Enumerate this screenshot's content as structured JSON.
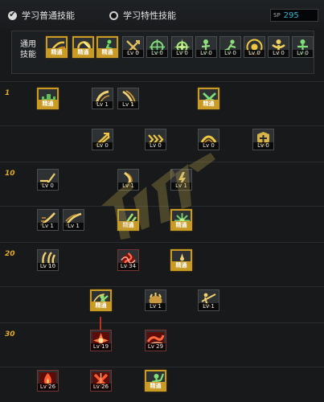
{
  "tabs": [
    {
      "label": "学习普通技能",
      "selected": true
    },
    {
      "label": "学习特性技能",
      "selected": false
    }
  ],
  "skill_points": {
    "label": "SP",
    "value": "295"
  },
  "common_skills": {
    "label": "通用技能",
    "items": [
      {
        "icon": "wind-slash-icon",
        "status": "精通"
      },
      {
        "icon": "spin-slash-icon",
        "status": "精通"
      },
      {
        "icon": "running-figure-icon",
        "status": "精通"
      },
      {
        "icon": "crossed-arrows-icon",
        "status": "Lv 0"
      },
      {
        "icon": "crosshair-icon",
        "status": "Lv 0"
      },
      {
        "icon": "crosshair-star-icon",
        "status": "Lv 0"
      },
      {
        "icon": "guard-figure-icon",
        "status": "Lv 0"
      },
      {
        "icon": "dash-figure-icon",
        "status": "Lv 0"
      },
      {
        "icon": "target-ring-icon",
        "status": "Lv 0"
      },
      {
        "icon": "muscle-figure-icon",
        "status": "Lv 0"
      },
      {
        "icon": "buff-figure-icon",
        "status": "Lv 0"
      }
    ]
  },
  "level_markers": [
    "1",
    "10",
    "20",
    "30"
  ],
  "tree": [
    {
      "icon": "castle-icon",
      "status": "精通",
      "style": "gold"
    },
    {
      "icon": "slash-arc-icon",
      "status": "Lv 1",
      "style": "normal"
    },
    {
      "icon": "claw-slash-icon",
      "status": "Lv 1",
      "style": "normal"
    },
    {
      "icon": "leaf-burst-icon",
      "status": "精通",
      "style": "gold"
    },
    {
      "icon": "flying-slash-icon",
      "status": "Lv 0",
      "style": "normal"
    },
    {
      "icon": "triple-chevron-icon",
      "status": "Lv 0",
      "style": "normal"
    },
    {
      "icon": "arc-sweep-icon",
      "status": "Lv 0",
      "style": "normal"
    },
    {
      "icon": "shield-cross-icon",
      "status": "Lv 0",
      "style": "normal"
    },
    {
      "icon": "dash-slash-icon",
      "status": "Lv 0",
      "style": "normal"
    },
    {
      "icon": "crescent-slash-icon",
      "status": "Lv 1",
      "style": "normal"
    },
    {
      "icon": "lightning-sword-icon",
      "status": "Lv 1",
      "style": "normal"
    },
    {
      "icon": "sweeping-blade-icon",
      "status": "Lv 1",
      "style": "normal"
    },
    {
      "icon": "wind-blade-icon",
      "status": "Lv 1",
      "style": "normal"
    },
    {
      "icon": "double-slash-icon",
      "status": "精通",
      "style": "gold"
    },
    {
      "icon": "thorn-burst-icon",
      "status": "精通",
      "style": "gold"
    },
    {
      "icon": "twin-blade-icon",
      "status": "Lv 10",
      "style": "normal"
    },
    {
      "icon": "red-vortex-icon",
      "status": "Lv 34",
      "style": "red"
    },
    {
      "icon": "meditation-icon",
      "status": "精通",
      "style": "gold"
    },
    {
      "icon": "swirl-hero-icon",
      "status": "精通",
      "style": "gold"
    },
    {
      "icon": "beast-claw-icon",
      "status": "Lv 1",
      "style": "normal"
    },
    {
      "icon": "spear-thrust-icon",
      "status": "Lv 1",
      "style": "normal"
    },
    {
      "icon": "red-burst-icon",
      "status": "Lv 19",
      "style": "red"
    },
    {
      "icon": "red-wave-icon",
      "status": "Lv 29",
      "style": "red"
    },
    {
      "icon": "red-flame-icon",
      "status": "Lv 26",
      "style": "red"
    },
    {
      "icon": "red-cross-icon",
      "status": "Lv 26",
      "style": "red"
    },
    {
      "icon": "green-warrior-icon",
      "status": "精通",
      "style": "gold"
    }
  ]
}
